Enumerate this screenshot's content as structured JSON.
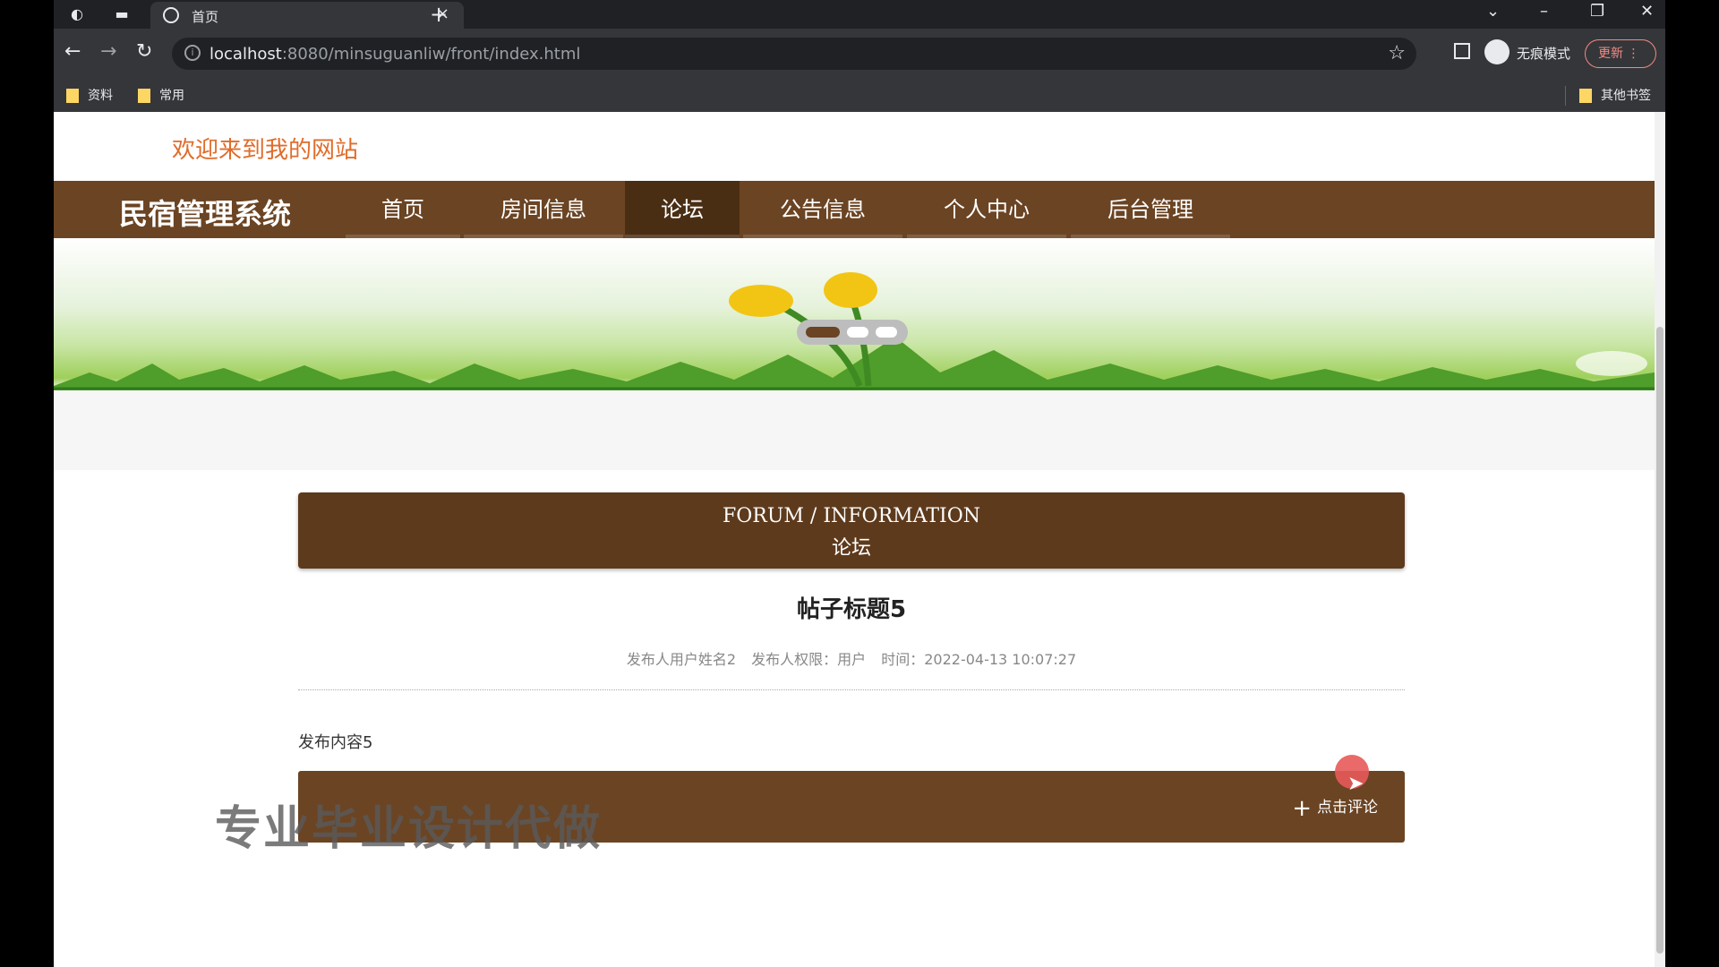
{
  "browser": {
    "tab_title": "首页",
    "tab_close": "×",
    "new_tab": "+",
    "url_host": "localhost",
    "url_path": ":8080/minsuguanliw/front/index.html",
    "incognito_label": "无痕模式",
    "update_label": "更新 ⋮",
    "bookmarks": [
      "资料",
      "常用"
    ],
    "other_bookmarks": "其他书签",
    "icons": [
      "back-icon",
      "forward-icon",
      "reload-icon",
      "info-icon",
      "star-icon",
      "sidebar-icon",
      "incognito-icon",
      "minimize-icon",
      "restore-icon",
      "close-icon"
    ]
  },
  "site": {
    "welcome": "欢迎来到我的网站",
    "brand": "民宿管理系统",
    "nav": [
      {
        "label": "首页"
      },
      {
        "label": "房间信息"
      },
      {
        "label": "论坛"
      },
      {
        "label": "公告信息"
      },
      {
        "label": "个人中心"
      },
      {
        "label": "后台管理"
      }
    ],
    "active_nav": "论坛"
  },
  "carousel": {
    "slide_count": 3,
    "active_index": 0
  },
  "forum_header": {
    "title_en": "FORUM / INFORMATION",
    "title_cn": "论坛"
  },
  "post": {
    "title": "帖子标题5",
    "author": "发布人用户姓名2",
    "role": "发布人权限：用户",
    "time": "时间：2022-04-13 10:07:27",
    "content": "发布内容5"
  },
  "comment": {
    "button_label": "点击评论"
  },
  "watermark": "专业毕业设计代做",
  "colors": {
    "brand_brown": "#6b4423",
    "active_brown": "#4a2e14",
    "welcome_orange": "#e06c2a"
  }
}
